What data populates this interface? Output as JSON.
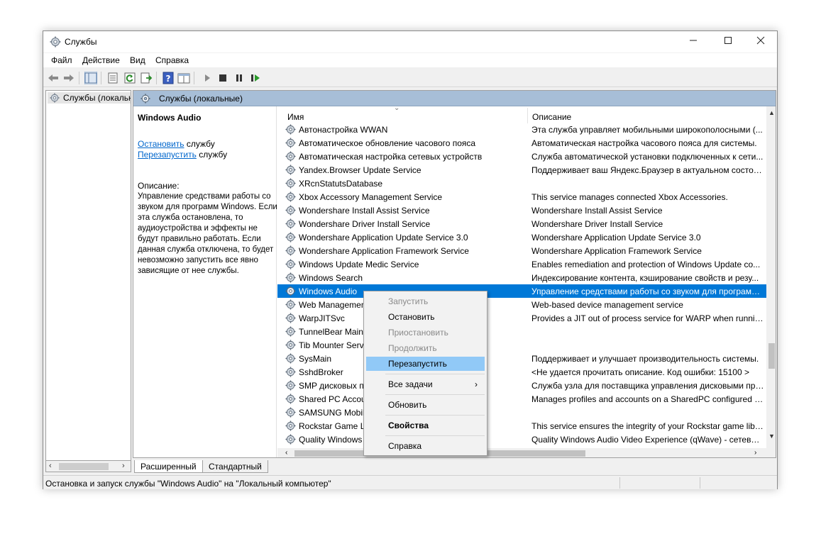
{
  "window": {
    "title": "Службы"
  },
  "menubar": {
    "items": [
      "Файл",
      "Действие",
      "Вид",
      "Справка"
    ]
  },
  "left_pane": {
    "item": "Службы (локальные)"
  },
  "right_header": {
    "title": "Службы (локальные)"
  },
  "details": {
    "service_name": "Windows Audio",
    "stop_link": "Остановить",
    "stop_suffix": " службу",
    "restart_link": "Перезапустить",
    "restart_suffix": " службу",
    "description_label": "Описание:",
    "description_text": "Управление средствами работы со звуком для программ Windows. Если эта служба остановлена, то аудиоустройства и эффекты не будут правильно работать. Если данная служба отключена, то будет невозможно запустить все явно зависящие от нее службы."
  },
  "columns": {
    "name": "Имя",
    "description": "Описание"
  },
  "services": [
    {
      "name": "Автонастройка WWAN",
      "description": "Эта служба управляет мобильными широкополосными (..."
    },
    {
      "name": "Автоматическое обновление часового пояса",
      "description": "Автоматическая настройка часового пояса для системы."
    },
    {
      "name": "Автоматическая настройка сетевых устройств",
      "description": "Служба автоматической установки подключенных к сети..."
    },
    {
      "name": "Yandex.Browser Update Service",
      "description": "Поддерживает ваш Яндекс.Браузер в актуальном состоян..."
    },
    {
      "name": "XRcnStatutsDatabase",
      "description": ""
    },
    {
      "name": "Xbox Accessory Management Service",
      "description": "This service manages connected Xbox Accessories."
    },
    {
      "name": "Wondershare Install Assist Service",
      "description": "Wondershare Install Assist Service"
    },
    {
      "name": "Wondershare Driver Install Service",
      "description": "Wondershare Driver Install Service"
    },
    {
      "name": "Wondershare Application Update Service 3.0",
      "description": "Wondershare Application Update Service 3.0"
    },
    {
      "name": "Wondershare Application Framework Service",
      "description": "Wondershare Application Framework Service"
    },
    {
      "name": "Windows Update Medic Service",
      "description": "Enables remediation and protection of Windows Update co..."
    },
    {
      "name": "Windows Search",
      "description": "Индексирование контента, кэширование свойств и резу..."
    },
    {
      "name": "Windows Audio",
      "description": "Управление средствами работы со звуком для программ ..."
    },
    {
      "name": "Web Managemen",
      "description": "Web-based device management service"
    },
    {
      "name": "WarpJITSvc",
      "description": "Provides a JIT out of process service for WARP when running..."
    },
    {
      "name": "TunnelBear Main",
      "description": ""
    },
    {
      "name": "Tib Mounter Serv",
      "description": ""
    },
    {
      "name": "SysMain",
      "description": "Поддерживает и улучшает производительность системы."
    },
    {
      "name": "SshdBroker",
      "description": "<Не удается прочитать описание. Код ошибки: 15100 >"
    },
    {
      "name": "SMP дисковых п",
      "description": "Служба узла для поставщика управления дисковыми про..."
    },
    {
      "name": "Shared PC Accou",
      "description": "Manages profiles and accounts on a SharedPC configured d..."
    },
    {
      "name": "SAMSUNG Mobil",
      "description": ""
    },
    {
      "name": "Rockstar Game Li",
      "description": "This service ensures the integrity of your Rockstar game libra..."
    },
    {
      "name": "Quality Windows",
      "description": "Quality Windows Audio Video Experience (qWave) - сетевая ..."
    }
  ],
  "selected_index": 12,
  "context_menu": {
    "start": "Запустить",
    "stop": "Остановить",
    "pause": "Приостановить",
    "resume": "Продолжить",
    "restart": "Перезапустить",
    "all_tasks": "Все задачи",
    "refresh": "Обновить",
    "properties": "Свойства",
    "help": "Справка"
  },
  "tabs": {
    "extended": "Расширенный",
    "standard": "Стандартный"
  },
  "status": {
    "text": "Остановка и запуск службы \"Windows Audio\" на \"Локальный компьютер\""
  },
  "colors": {
    "selection": "#0078d7",
    "header": "#a7bed7",
    "menu_hover": "#91c9f7",
    "link": "#0066cc"
  }
}
